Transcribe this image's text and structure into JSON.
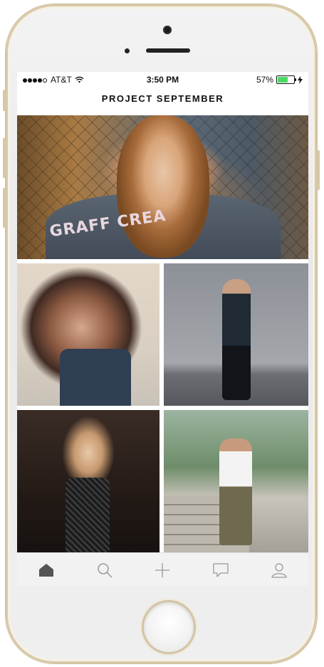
{
  "status_bar": {
    "carrier": "AT&T",
    "time": "3:50 PM",
    "battery_percent": "57%",
    "battery_level": 0.57,
    "signal_icon": "signal-dots-icon",
    "wifi_icon": "wifi-icon",
    "charging_icon": "charging-bolt-icon"
  },
  "header": {
    "title": "PROJECT SEPTEMBER"
  },
  "feed": {
    "hero_text": "GRAFF CREA",
    "photos": [
      {
        "description": "woman-denim-jacket"
      },
      {
        "description": "woman-overalls"
      },
      {
        "description": "man-dark-outfit"
      },
      {
        "description": "woman-lace-top"
      },
      {
        "description": "man-camo-pants"
      }
    ]
  },
  "tab_bar": {
    "items": [
      {
        "name": "home",
        "icon": "home-icon",
        "active": true
      },
      {
        "name": "search",
        "icon": "search-icon",
        "active": false
      },
      {
        "name": "add",
        "icon": "plus-icon",
        "active": false
      },
      {
        "name": "messages",
        "icon": "chat-bubble-icon",
        "active": false
      },
      {
        "name": "profile",
        "icon": "user-icon",
        "active": false
      }
    ]
  },
  "colors": {
    "battery_fill": "#4cd964",
    "active_tab": "#555555",
    "inactive_tab": "#9a9a9a"
  }
}
